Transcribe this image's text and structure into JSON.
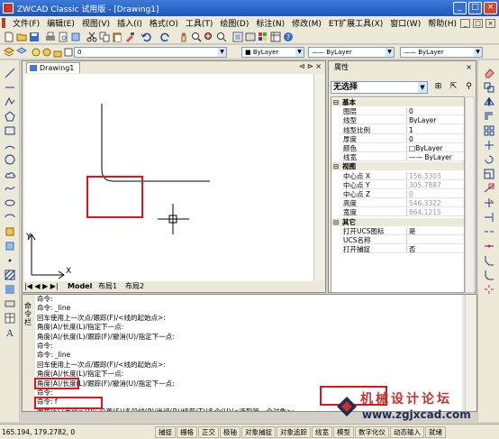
{
  "window": {
    "title": "ZWCAD Classic 试用版 - [Drawing1]",
    "controls": [
      "_",
      "□",
      "×"
    ]
  },
  "menu": [
    "文件(F)",
    "编辑(E)",
    "视图(V)",
    "插入(I)",
    "格式(O)",
    "工具(T)",
    "绘图(D)",
    "标注(N)",
    "修改(M)",
    "ET扩展工具(X)",
    "窗口(W)",
    "帮助(H)"
  ],
  "layer": {
    "combo_value": "0",
    "color": "ByLayer",
    "linetype": "ByLayer",
    "lineweight": "ByLayer"
  },
  "drawing": {
    "tab_label": "Drawing1",
    "tab_controls": "⊲ ⊳ ×",
    "axis_y": "Y",
    "axis_x": "X",
    "layout_tabs": [
      "Model",
      "布局1",
      "布局2"
    ]
  },
  "properties": {
    "title": "属性",
    "selection": "无选择",
    "rows": [
      {
        "type": "section",
        "label": "基本"
      },
      {
        "label": "图层",
        "value": "0"
      },
      {
        "label": "线型",
        "value": "ByLayer"
      },
      {
        "label": "线型比例",
        "value": "1"
      },
      {
        "label": "厚度",
        "value": "0"
      },
      {
        "label": "颜色",
        "value": "□ByLayer"
      },
      {
        "label": "线宽",
        "value": "—— ByLayer"
      },
      {
        "type": "section",
        "label": "视图"
      },
      {
        "label": "中心点 X",
        "value": "156.3303",
        "gray": true
      },
      {
        "label": "中心点 Y",
        "value": "305.7887",
        "gray": true
      },
      {
        "label": "中心点 Z",
        "value": "0",
        "gray": true
      },
      {
        "label": "高度",
        "value": "546.3322",
        "gray": true
      },
      {
        "label": "宽度",
        "value": "864.1215",
        "gray": true
      },
      {
        "type": "section",
        "label": "其它"
      },
      {
        "label": "打开UCS图标",
        "value": "是"
      },
      {
        "label": "UCS名称",
        "value": ""
      },
      {
        "label": "打开捕捉",
        "value": "否"
      }
    ]
  },
  "command": {
    "side_label": "命令栏",
    "lines": [
      "命令:",
      "命令: _line",
      "回车使用上一次点/跟踪(F)/<线的起始点>:",
      "角度(A)/长度(L)/指定下一点:",
      "角度(A)/长度(L)/跟踪(F)/撤消(U)/指定下一点:",
      "命令:",
      "命令: _line",
      "回车使用上一次点/跟踪(F)/<线的起始点>:",
      "角度(A)/长度(L)/指定下一点:",
      "角度(A)/长度(L)/跟踪(F)/撤消(U)/指定下一点:",
      "命令:",
      "命令: f",
      "圆角(F) (半径=10): 设置(S)/多段线(P)/半径(R)/修剪(T)/多个(U)/<选取第一个对象>:",
      "选取第二个对象:",
      "命令:"
    ]
  },
  "status": {
    "coords": "165.194, 179.2782, 0",
    "buttons": [
      "捕捉",
      "栅格",
      "正交",
      "极轴",
      "对象捕捉",
      "对象追踪",
      "线宽",
      "模型",
      "数字化仪",
      "动态输入",
      "就绪"
    ]
  },
  "watermark": {
    "cn": "机械设计论坛",
    "url": "www.zgjxcad.com"
  },
  "colors": {
    "title_blue": "#1f56b8",
    "highlight_red": "#e0141e",
    "watermark_red": "#c8322a",
    "watermark_navy": "#1e2d55"
  }
}
